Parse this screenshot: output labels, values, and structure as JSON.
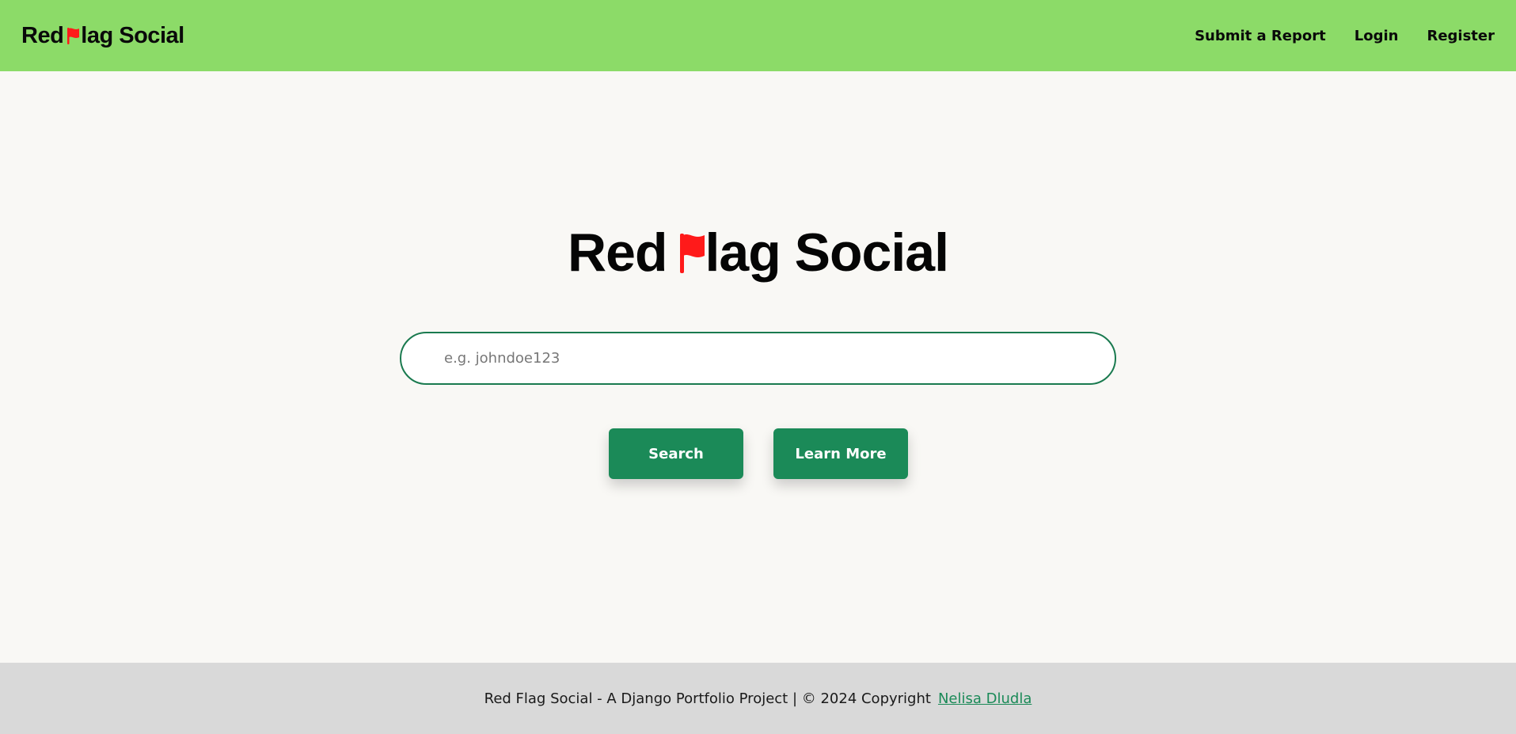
{
  "header": {
    "brand_prefix": "Red ",
    "brand_suffix": "lag Social",
    "nav": {
      "submit_report": "Submit a Report",
      "login": "Login",
      "register": "Register"
    }
  },
  "hero": {
    "title_prefix": "Red ",
    "title_suffix": "lag Social",
    "search_placeholder": "e.g. johndoe123",
    "search_value": "",
    "search_button": "Search",
    "learn_more_button": "Learn More"
  },
  "footer": {
    "text": "Red Flag Social - A Django Portfolio Project | © 2024 Copyright",
    "author_link": "Nelisa Dludla"
  },
  "colors": {
    "header_bg": "#8cdb68",
    "page_bg": "#f9f8f5",
    "accent_green": "#1b8a58",
    "flag_red": "#ff1a1a",
    "footer_bg": "#d9d9d9"
  },
  "icons": {
    "brand_flag": "red-flag-icon",
    "title_flag": "red-flag-icon"
  }
}
